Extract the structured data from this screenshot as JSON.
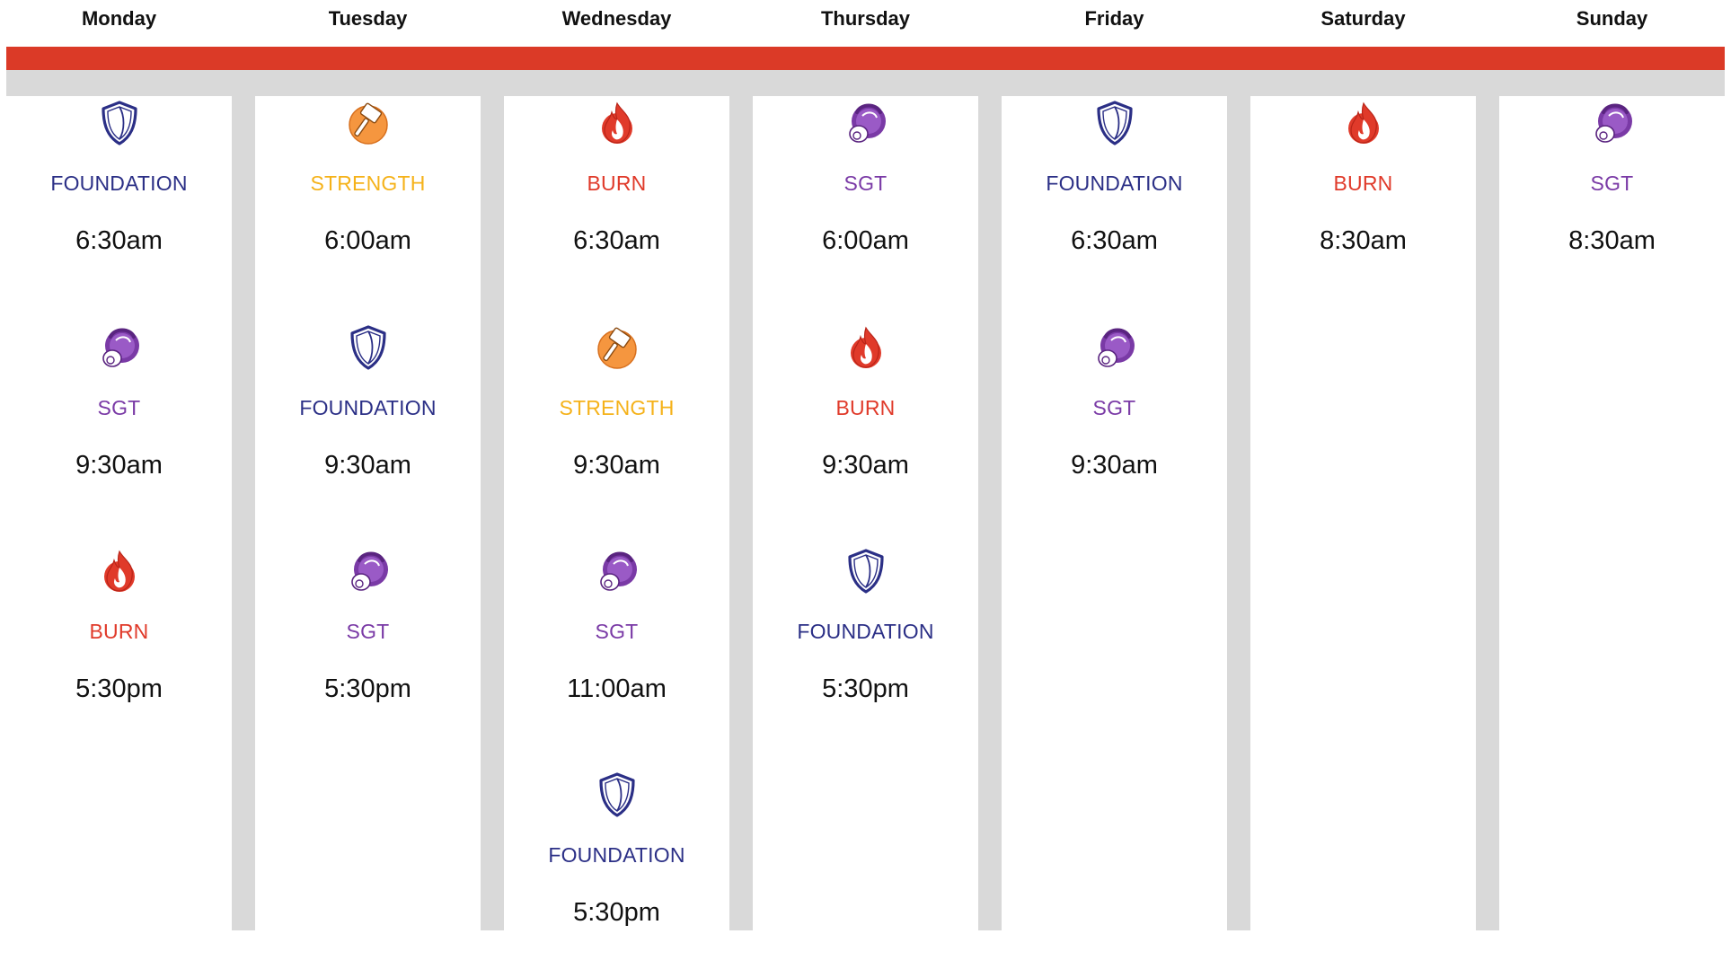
{
  "colors": {
    "accent_bar": "#db3a27",
    "gutter": "#d9d9d9",
    "foundation": "#2b2f86",
    "strength": "#f5b21a",
    "burn": "#e03a2a",
    "sgt": "#7a3aa6"
  },
  "classes": {
    "foundation": {
      "label": "FOUNDATION",
      "icon": "shield-icon"
    },
    "strength": {
      "label": "STRENGTH",
      "icon": "hammer-icon"
    },
    "burn": {
      "label": "BURN",
      "icon": "flame-icon"
    },
    "sgt": {
      "label": "SGT",
      "icon": "kettlebell-icon"
    }
  },
  "days": [
    {
      "name": "Monday",
      "sessions": [
        {
          "type": "foundation",
          "label": "FOUNDATION",
          "time": "6:30am"
        },
        {
          "type": "sgt",
          "label": "SGT",
          "time": "9:30am"
        },
        {
          "type": "burn",
          "label": "BURN",
          "time": "5:30pm"
        }
      ]
    },
    {
      "name": "Tuesday",
      "sessions": [
        {
          "type": "strength",
          "label": "STRENGTH",
          "time": "6:00am"
        },
        {
          "type": "foundation",
          "label": "FOUNDATION",
          "time": "9:30am"
        },
        {
          "type": "sgt",
          "label": "SGT",
          "time": "5:30pm"
        }
      ]
    },
    {
      "name": "Wednesday",
      "sessions": [
        {
          "type": "burn",
          "label": "BURN",
          "time": "6:30am"
        },
        {
          "type": "strength",
          "label": "STRENGTH",
          "time": "9:30am"
        },
        {
          "type": "sgt",
          "label": "SGT",
          "time": "11:00am"
        },
        {
          "type": "foundation",
          "label": "FOUNDATION",
          "time": "5:30pm"
        }
      ]
    },
    {
      "name": "Thursday",
      "sessions": [
        {
          "type": "sgt",
          "label": "SGT",
          "time": "6:00am"
        },
        {
          "type": "burn",
          "label": "BURN",
          "time": "9:30am"
        },
        {
          "type": "foundation",
          "label": "FOUNDATION",
          "time": "5:30pm"
        }
      ]
    },
    {
      "name": "Friday",
      "sessions": [
        {
          "type": "foundation",
          "label": "FOUNDATION",
          "time": "6:30am"
        },
        {
          "type": "sgt",
          "label": "SGT",
          "time": "9:30am"
        }
      ]
    },
    {
      "name": "Saturday",
      "sessions": [
        {
          "type": "burn",
          "label": "BURN",
          "time": "8:30am"
        }
      ]
    },
    {
      "name": "Sunday",
      "sessions": [
        {
          "type": "sgt",
          "label": "SGT",
          "time": "8:30am"
        }
      ]
    }
  ]
}
